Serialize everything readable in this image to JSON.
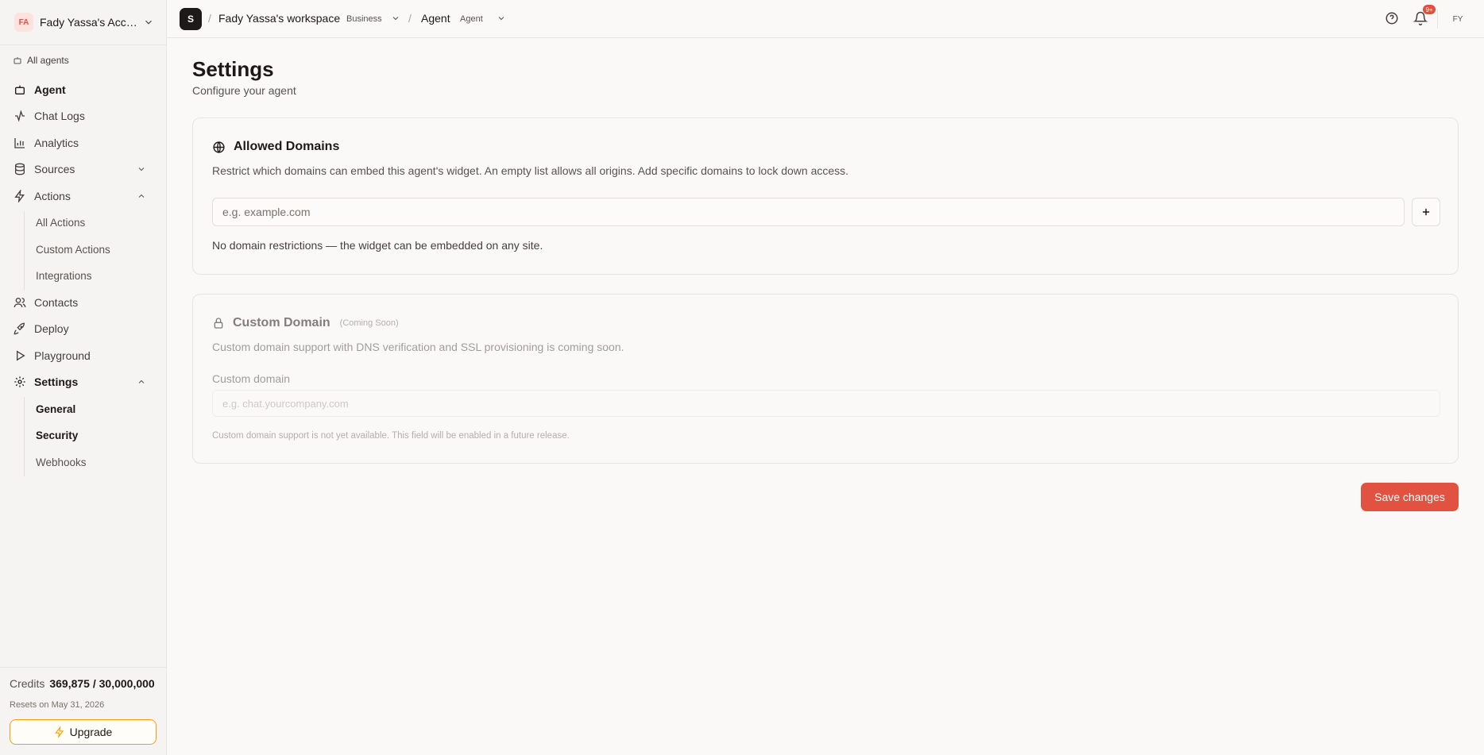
{
  "account": {
    "initials": "FA",
    "name": "Fady Yassa's Acco..."
  },
  "sidebar": {
    "all_agents": "All agents",
    "items": [
      {
        "label": "Agent",
        "icon": "bot-icon"
      },
      {
        "label": "Chat Logs",
        "icon": "activity-icon"
      },
      {
        "label": "Analytics",
        "icon": "bar-chart-icon"
      },
      {
        "label": "Sources",
        "icon": "database-icon"
      },
      {
        "label": "Actions",
        "icon": "zap-icon"
      },
      {
        "label": "Contacts",
        "icon": "users-icon"
      },
      {
        "label": "Deploy",
        "icon": "rocket-icon"
      },
      {
        "label": "Playground",
        "icon": "play-icon"
      },
      {
        "label": "Settings",
        "icon": "gear-icon"
      }
    ],
    "actions_sub": [
      "All Actions",
      "Custom Actions",
      "Integrations"
    ],
    "settings_sub": [
      "General",
      "Security",
      "Webhooks"
    ]
  },
  "credits": {
    "label": "Credits",
    "value": "369,875 / 30,000,000",
    "resets": "Resets on May 31, 2026",
    "upgrade": "Upgrade"
  },
  "topbar": {
    "logo": "S",
    "workspace": "Fady Yassa's workspace",
    "workspace_badge": "Business",
    "agent": "Agent",
    "agent_badge": "Agent",
    "notif_count": "9+",
    "user_initials": "FY"
  },
  "page": {
    "title": "Settings",
    "subtitle": "Configure your agent"
  },
  "allowed_domains": {
    "title": "Allowed Domains",
    "description": "Restrict which domains can embed this agent's widget. An empty list allows all origins. Add specific domains to lock down access.",
    "placeholder": "e.g. example.com",
    "note": "No domain restrictions — the widget can be embedded on any site."
  },
  "custom_domain": {
    "title": "Custom Domain",
    "badge": "(Coming Soon)",
    "description": "Custom domain support with DNS verification and SSL provisioning is coming soon.",
    "field_label": "Custom domain",
    "placeholder": "e.g. chat.yourcompany.com",
    "help": "Custom domain support is not yet available. This field will be enabled in a future release."
  },
  "save_label": "Save changes",
  "colors": {
    "accent": "#e15241",
    "upgrade_border": "#f59e0b"
  }
}
